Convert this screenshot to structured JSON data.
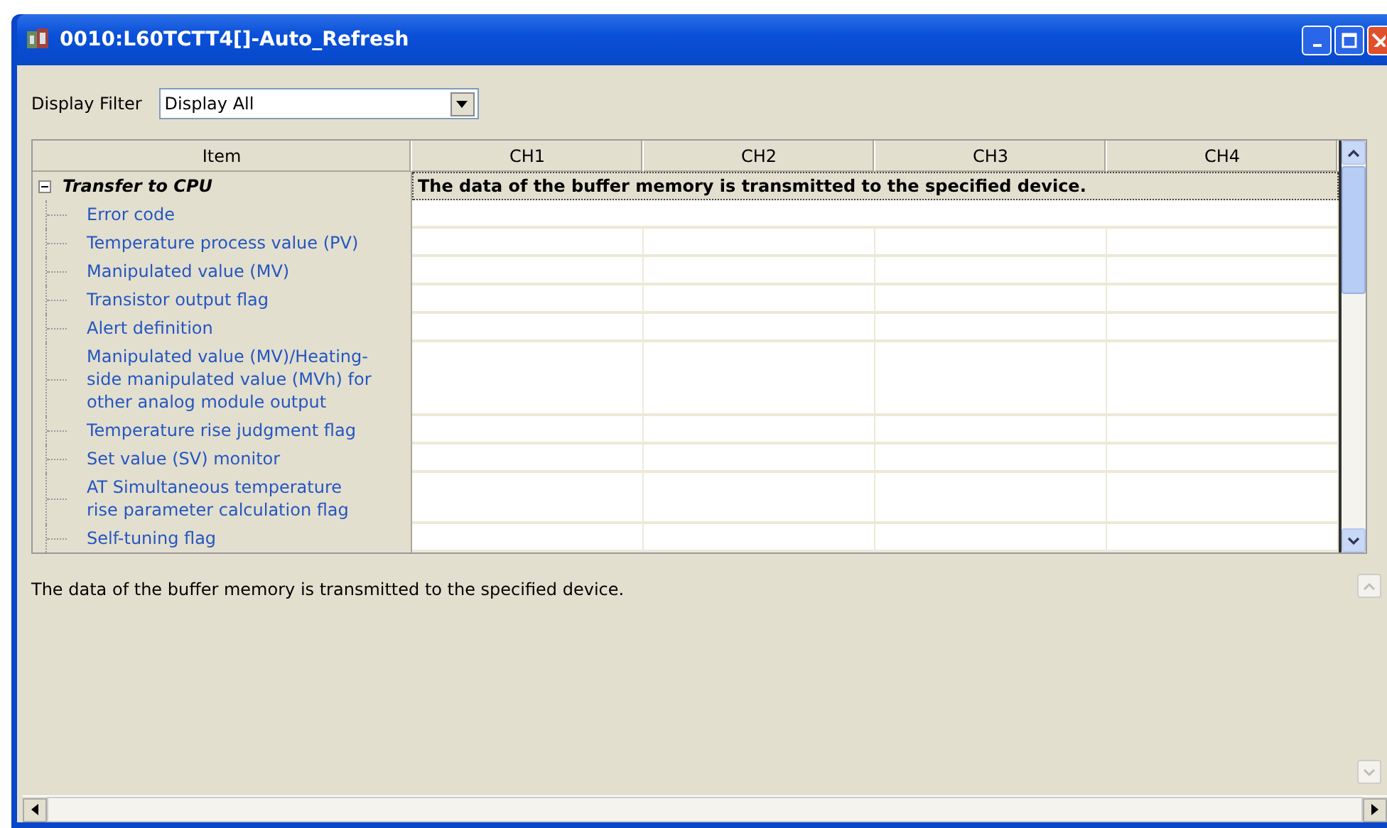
{
  "window": {
    "title": "0010:L60TCTT4[]-Auto_Refresh"
  },
  "filter": {
    "label": "Display Filter",
    "value": "Display All"
  },
  "table": {
    "columns": [
      "Item",
      "CH1",
      "CH2",
      "CH3",
      "CH4"
    ],
    "groups": [
      {
        "label": "Transfer to CPU",
        "expanded": true,
        "note": "The data of the buffer memory is transmitted to the specified device.",
        "rows": [
          {
            "label": "Error code",
            "kind": "module"
          },
          {
            "label": "Temperature process value (PV)",
            "kind": "channel"
          },
          {
            "label": "Manipulated value (MV)",
            "kind": "channel"
          },
          {
            "label": "Transistor output flag",
            "kind": "channel"
          },
          {
            "label": "Alert definition",
            "kind": "channel"
          },
          {
            "label": "Manipulated value (MV)/Heating-side manipulated value (MVh) for other analog module output",
            "kind": "channel"
          },
          {
            "label": "Temperature rise judgment flag",
            "kind": "channel"
          },
          {
            "label": "Set value (SV) monitor",
            "kind": "channel"
          },
          {
            "label": "AT Simultaneous temperature rise parameter calculation flag",
            "kind": "channel"
          },
          {
            "label": "Self-tuning flag",
            "kind": "channel"
          }
        ]
      }
    ]
  },
  "description": "The data of the buffer memory is transmitted to the specified device."
}
